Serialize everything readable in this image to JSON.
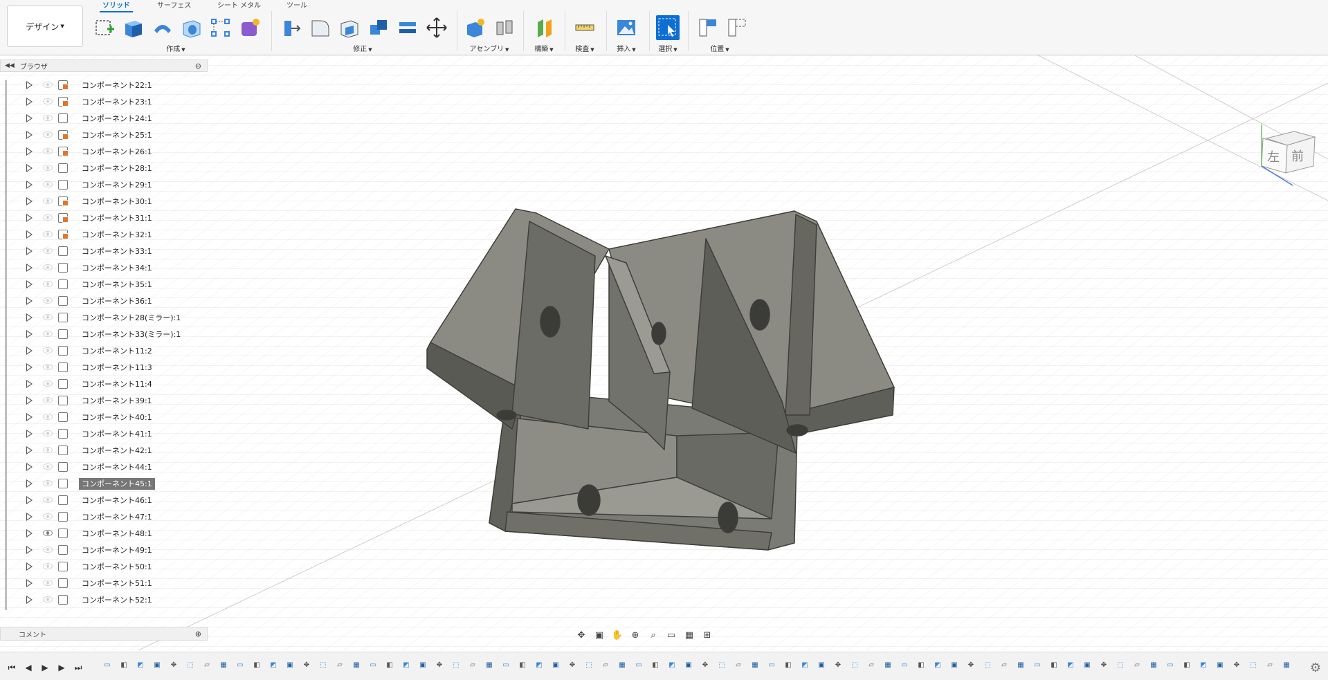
{
  "workspace": {
    "label": "デザイン"
  },
  "tabs": [
    {
      "label": "ソリッド",
      "active": true
    },
    {
      "label": "サーフェス",
      "active": false
    },
    {
      "label": "シート メタル",
      "active": false
    },
    {
      "label": "ツール",
      "active": false
    }
  ],
  "groups": [
    {
      "label": "作成"
    },
    {
      "label": "修正"
    },
    {
      "label": "アセンブリ"
    },
    {
      "label": "構築"
    },
    {
      "label": "検査"
    },
    {
      "label": "挿入"
    },
    {
      "label": "選択"
    },
    {
      "label": "位置"
    }
  ],
  "browser": {
    "title": "ブラウザ",
    "items": [
      {
        "label": "コンポーネント22:1",
        "linked": true
      },
      {
        "label": "コンポーネント23:1",
        "linked": true
      },
      {
        "label": "コンポーネント24:1",
        "linked": false
      },
      {
        "label": "コンポーネント25:1",
        "linked": true
      },
      {
        "label": "コンポーネント26:1",
        "linked": true
      },
      {
        "label": "コンポーネント28:1",
        "linked": false
      },
      {
        "label": "コンポーネント29:1",
        "linked": false
      },
      {
        "label": "コンポーネント30:1",
        "linked": true
      },
      {
        "label": "コンポーネント31:1",
        "linked": true
      },
      {
        "label": "コンポーネント32:1",
        "linked": true
      },
      {
        "label": "コンポーネント33:1",
        "linked": false
      },
      {
        "label": "コンポーネント34:1",
        "linked": false
      },
      {
        "label": "コンポーネント35:1",
        "linked": false
      },
      {
        "label": "コンポーネント36:1",
        "linked": false
      },
      {
        "label": "コンポーネント28(ミラー):1",
        "linked": false
      },
      {
        "label": "コンポーネント33(ミラー):1",
        "linked": false
      },
      {
        "label": "コンポーネント11:2",
        "linked": false
      },
      {
        "label": "コンポーネント11:3",
        "linked": false
      },
      {
        "label": "コンポーネント11:4",
        "linked": false
      },
      {
        "label": "コンポーネント39:1",
        "linked": false
      },
      {
        "label": "コンポーネント40:1",
        "linked": false
      },
      {
        "label": "コンポーネント41:1",
        "linked": false
      },
      {
        "label": "コンポーネント42:1",
        "linked": false
      },
      {
        "label": "コンポーネント44:1",
        "linked": false
      },
      {
        "label": "コンポーネント45:1",
        "linked": false,
        "selected": true
      },
      {
        "label": "コンポーネント46:1",
        "linked": false
      },
      {
        "label": "コンポーネント47:1",
        "linked": false
      },
      {
        "label": "コンポーネント48:1",
        "linked": false,
        "visible": true
      },
      {
        "label": "コンポーネント49:1",
        "linked": false
      },
      {
        "label": "コンポーネント50:1",
        "linked": false
      },
      {
        "label": "コンポーネント51:1",
        "linked": false
      },
      {
        "label": "コンポーネント52:1",
        "linked": false
      }
    ]
  },
  "comments": {
    "title": "コメント"
  },
  "viewcube": {
    "left_label": "左",
    "front_label": "前"
  },
  "colors": {
    "accent": "#0d6fd1",
    "model_face": "#8a8a84",
    "model_shadow": "#5e5e5a",
    "grid": "#d6d6d6"
  }
}
